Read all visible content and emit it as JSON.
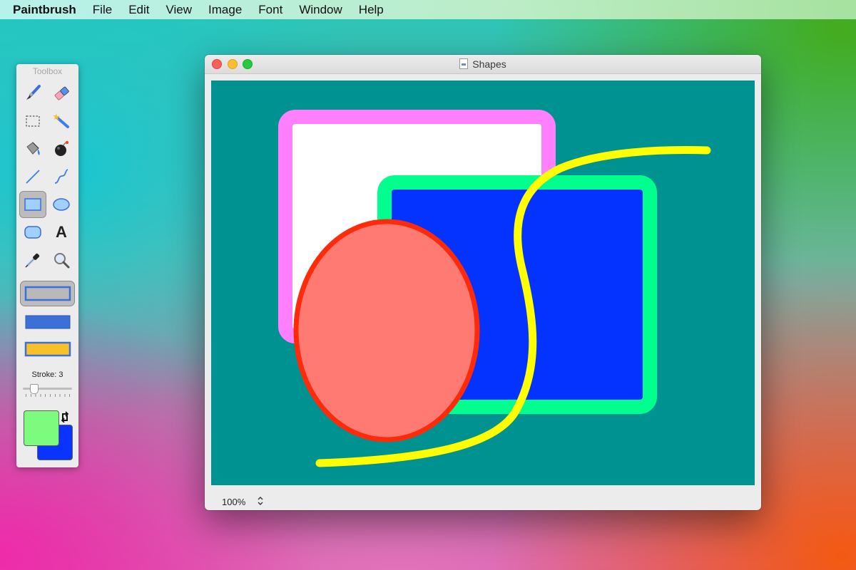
{
  "menubar": {
    "app_name": "Paintbrush",
    "items": [
      "File",
      "Edit",
      "View",
      "Image",
      "Font",
      "Window",
      "Help"
    ]
  },
  "toolbox": {
    "title": "Toolbox",
    "tools": [
      {
        "name": "paintbrush-icon",
        "selected": false
      },
      {
        "name": "eraser-icon",
        "selected": false
      },
      {
        "name": "selection-icon",
        "selected": false
      },
      {
        "name": "magic-wand-icon",
        "selected": false
      },
      {
        "name": "paint-bucket-icon",
        "selected": false
      },
      {
        "name": "bomb-icon",
        "selected": false
      },
      {
        "name": "line-icon",
        "selected": false
      },
      {
        "name": "curve-icon",
        "selected": false
      },
      {
        "name": "rectangle-icon",
        "selected": true
      },
      {
        "name": "ellipse-icon",
        "selected": false
      },
      {
        "name": "rounded-rectangle-icon",
        "selected": false
      },
      {
        "name": "text-icon",
        "selected": false
      },
      {
        "name": "eyedropper-icon",
        "selected": false
      },
      {
        "name": "zoom-icon",
        "selected": false
      }
    ],
    "text_tool_glyph": "A",
    "fill_styles": [
      "outline-only",
      "fill-only",
      "fill-and-outline"
    ],
    "selected_fill_style": "outline-only",
    "stroke_label": "Stroke: 3",
    "stroke_value": 3,
    "foreground_color": "#7dfb7e",
    "background_color": "#0a33ff"
  },
  "window": {
    "title": "Shapes",
    "zoom": "100%"
  },
  "canvas": {
    "background": "#009191",
    "colors": {
      "pink_outline": "#ff80ff",
      "white_fill": "#ffffff",
      "green_outline": "#00ff8c",
      "blue_fill": "#0433ff",
      "red_outline": "#ff2a0a",
      "salmon_fill": "#ff7a73",
      "yellow_stroke": "#ffff00"
    }
  }
}
